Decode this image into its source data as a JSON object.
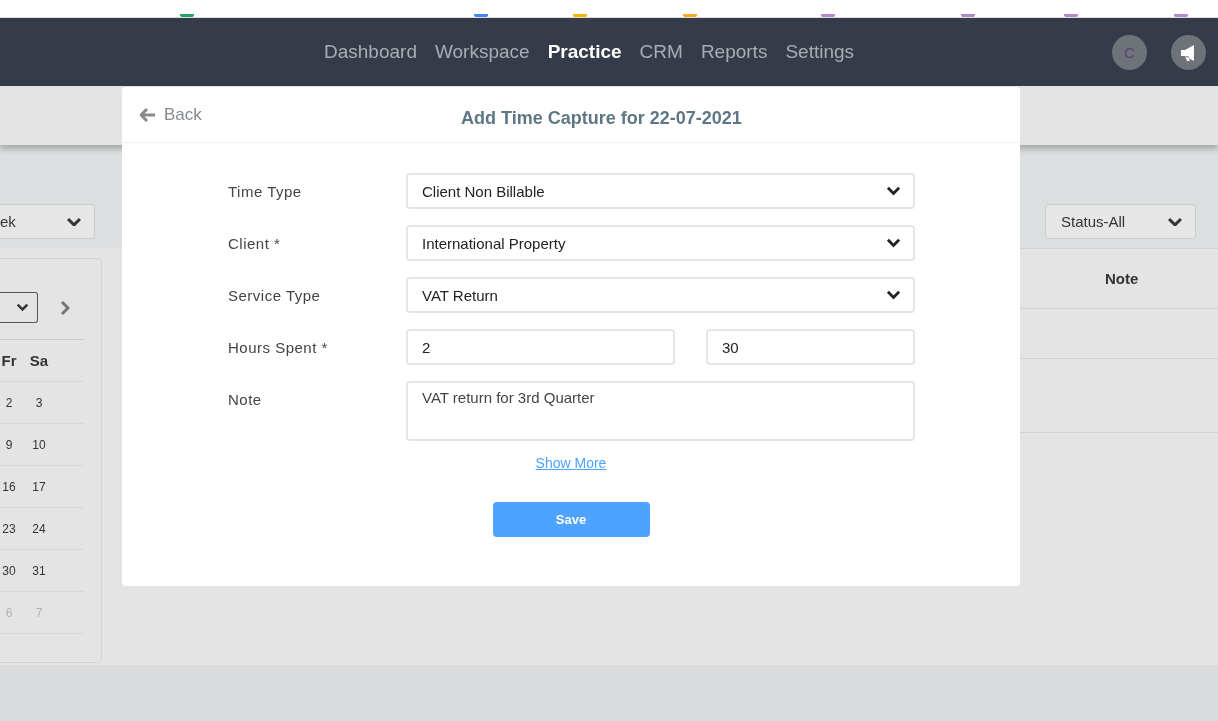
{
  "top_strip": {
    "icons": [
      {
        "color": "#1fa463"
      },
      {
        "color": "#4285f4"
      },
      {
        "color": "#f4b400"
      },
      {
        "color": "#f9a825"
      },
      {
        "color": "#b388c9"
      },
      {
        "color": "#b388c9"
      },
      {
        "color": "#b388c9"
      },
      {
        "color": "#b388c9"
      }
    ]
  },
  "nav": {
    "items": [
      {
        "label": "Dashboard",
        "selected": false
      },
      {
        "label": "Workspace",
        "selected": false
      },
      {
        "label": "Practice",
        "selected": true
      },
      {
        "label": "CRM",
        "selected": false
      },
      {
        "label": "Reports",
        "selected": false
      },
      {
        "label": "Settings",
        "selected": false
      }
    ],
    "avatar_initial": "C"
  },
  "filters": {
    "period": "ek",
    "status": "Status-All"
  },
  "calendar": {
    "weekdays": [
      "Fr",
      "Sa"
    ],
    "weeks": [
      [
        {
          "day": "2",
          "muted": false
        },
        {
          "day": "3",
          "muted": false
        }
      ],
      [
        {
          "day": "9",
          "muted": false
        },
        {
          "day": "10",
          "muted": false
        }
      ],
      [
        {
          "day": "16",
          "muted": false
        },
        {
          "day": "17",
          "muted": false
        }
      ],
      [
        {
          "day": "23",
          "muted": false
        },
        {
          "day": "24",
          "muted": false
        }
      ],
      [
        {
          "day": "30",
          "muted": false
        },
        {
          "day": "31",
          "muted": false
        }
      ],
      [
        {
          "day": "6",
          "muted": true
        },
        {
          "day": "7",
          "muted": true
        }
      ]
    ]
  },
  "table": {
    "columns": [
      "Note"
    ]
  },
  "modal": {
    "back": "Back",
    "title": "Add Time Capture for 22-07-2021",
    "rows": [
      {
        "label": "Time Type",
        "fields": [
          {
            "kind": "select",
            "value": "Client Non Billable"
          }
        ]
      },
      {
        "label": "Client *",
        "fields": [
          {
            "kind": "select",
            "value": "International Property"
          }
        ]
      },
      {
        "label": "Service Type",
        "fields": [
          {
            "kind": "select",
            "value": "VAT Return"
          }
        ]
      },
      {
        "label": "Hours Spent *",
        "fields": [
          {
            "kind": "text",
            "value": "2"
          },
          {
            "kind": "text",
            "value": "30"
          }
        ]
      },
      {
        "label": "Note",
        "fields": [
          {
            "kind": "textarea",
            "value": "VAT return for 3rd Quarter"
          }
        ]
      }
    ],
    "show_more": "Show More",
    "save": "Save"
  }
}
